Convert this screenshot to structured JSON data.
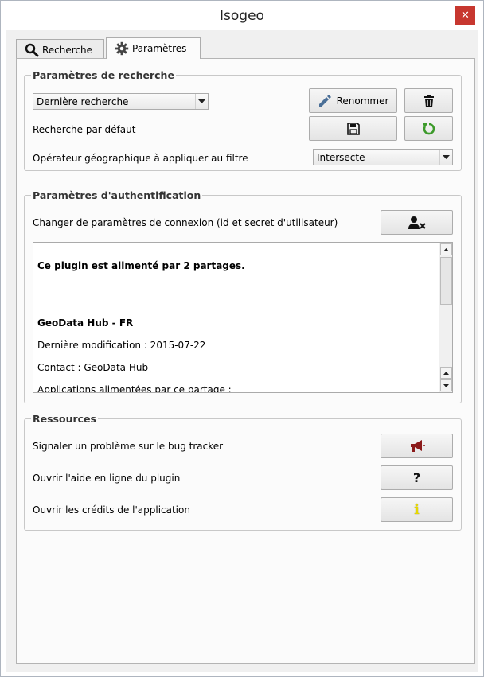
{
  "window": {
    "title": "Isogeo"
  },
  "tabs": [
    {
      "label": "Recherche"
    },
    {
      "label": "Paramètres"
    }
  ],
  "search_params": {
    "title": "Paramètres de recherche",
    "saved_search_value": "Dernière recherche",
    "rename_label": "Renommer",
    "default_search_label": "Recherche par défaut",
    "geo_operator_label": "Opérateur géographique à appliquer au filtre",
    "geo_operator_value": "Intersecte"
  },
  "auth": {
    "title": "Paramètres d'authentification",
    "change_label": "Changer de paramètres de connexion (id et secret d'utilisateur)",
    "info_heading": "Ce plugin est alimenté par 2 partages.",
    "share_name": "GeoData Hub - FR",
    "last_modified": "Dernière modification : 2015-07-22",
    "contact": "Contact : GeoData Hub",
    "apps": "Applications alimentées par ce partage :"
  },
  "resources": {
    "title": "Ressources",
    "bug_label": "Signaler un problème sur le bug tracker",
    "help_label": "Ouvrir l'aide en ligne du plugin",
    "help_button_glyph": "?",
    "credits_label": "Ouvrir les crédits de l'application",
    "credits_button_glyph": "i"
  },
  "colors": {
    "close_button": "#c7372f",
    "reset_icon": "#3c9a2a",
    "bug_icon": "#8b1a1a",
    "info_icon": "#e6d800"
  }
}
